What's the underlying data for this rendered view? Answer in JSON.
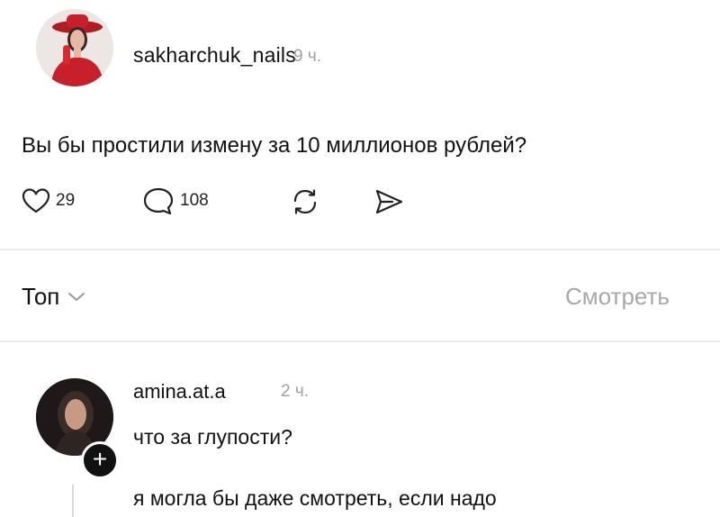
{
  "post": {
    "username": "sakharchuk_nails",
    "time": "9 ч.",
    "text": "Вы бы простили измену за 10 миллионов рублей?",
    "likes": "29",
    "comments": "108"
  },
  "sort": {
    "label": "Топ",
    "watch_label": "Смотреть"
  },
  "comment": {
    "username": "amina.at.a",
    "time": "2 ч.",
    "text": "что за глупости?",
    "badge": "+"
  },
  "reply": {
    "text": "я могла бы даже смотреть, если надо"
  },
  "colors": {
    "text": "#111111",
    "muted": "#a0a0a0",
    "avatar_red": "#c8202a"
  }
}
